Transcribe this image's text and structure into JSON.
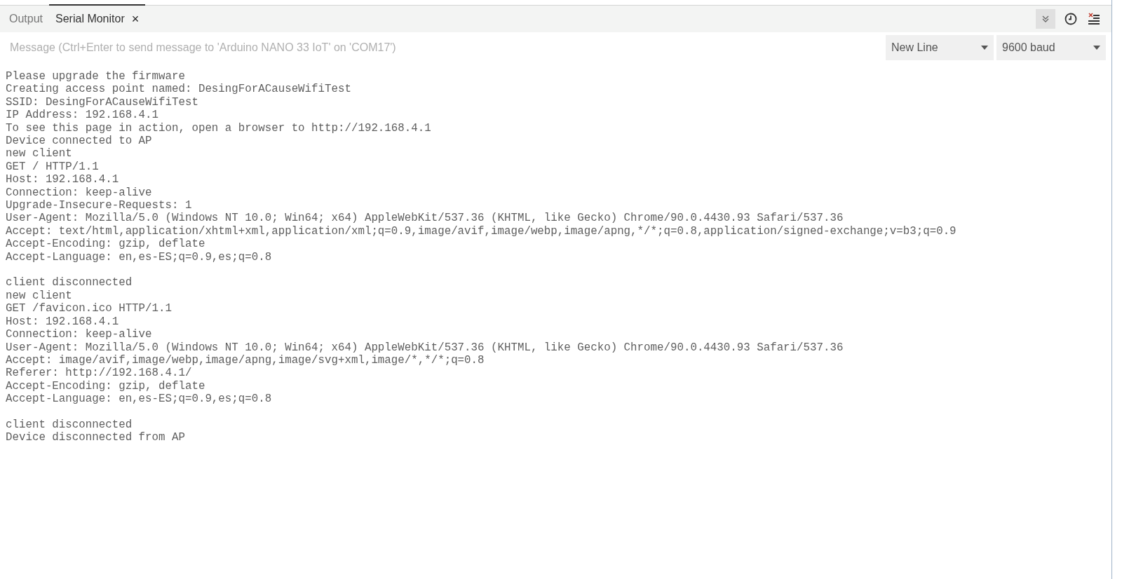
{
  "tabs": [
    {
      "label": "Output",
      "selected": false
    },
    {
      "label": "Serial Monitor",
      "selected": true,
      "close": "×"
    }
  ],
  "toolbar": {
    "autoscroll": {
      "on": true
    }
  },
  "message": {
    "placeholder": "Message (Ctrl+Enter to send message to 'Arduino NANO 33 IoT' on 'COM17')"
  },
  "line_ending": {
    "value": "New Line"
  },
  "baud_rate": {
    "value": "9600 baud"
  },
  "output_blocks": [
    {
      "lines": [
        "Please upgrade the firmware",
        "Creating access point named: DesingForACauseWifiTest",
        "SSID: DesingForACauseWifiTest",
        "IP Address: 192.168.4.1",
        "To see this page in action, open a browser to http://192.168.4.1",
        "Device connected to AP",
        "new client",
        "GET / HTTP/1.1",
        "Host: 192.168.4.1",
        "Connection: keep-alive",
        "Upgrade-Insecure-Requests: 1",
        "User-Agent: Mozilla/5.0 (Windows NT 10.0; Win64; x64) AppleWebKit/537.36 (KHTML, like Gecko) Chrome/90.0.4430.93 Safari/537.36",
        "Accept: text/html,application/xhtml+xml,application/xml;q=0.9,image/avif,image/webp,image/apng,*/*;q=0.8,application/signed-exchange;v=b3;q=0.9",
        "Accept-Encoding: gzip, deflate",
        "Accept-Language: en,es-ES;q=0.9,es;q=0.8"
      ]
    },
    {
      "lines": [
        "client disconnected",
        "new client",
        "GET /favicon.ico HTTP/1.1",
        "Host: 192.168.4.1",
        "Connection: keep-alive",
        "User-Agent: Mozilla/5.0 (Windows NT 10.0; Win64; x64) AppleWebKit/537.36 (KHTML, like Gecko) Chrome/90.0.4430.93 Safari/537.36",
        "Accept: image/avif,image/webp,image/apng,image/svg+xml,image/*,*/*;q=0.8",
        "Referer: http://192.168.4.1/",
        "Accept-Encoding: gzip, deflate",
        "Accept-Language: en,es-ES;q=0.9,es;q=0.8"
      ]
    },
    {
      "lines": [
        "client disconnected",
        "Device disconnected from AP"
      ]
    }
  ]
}
